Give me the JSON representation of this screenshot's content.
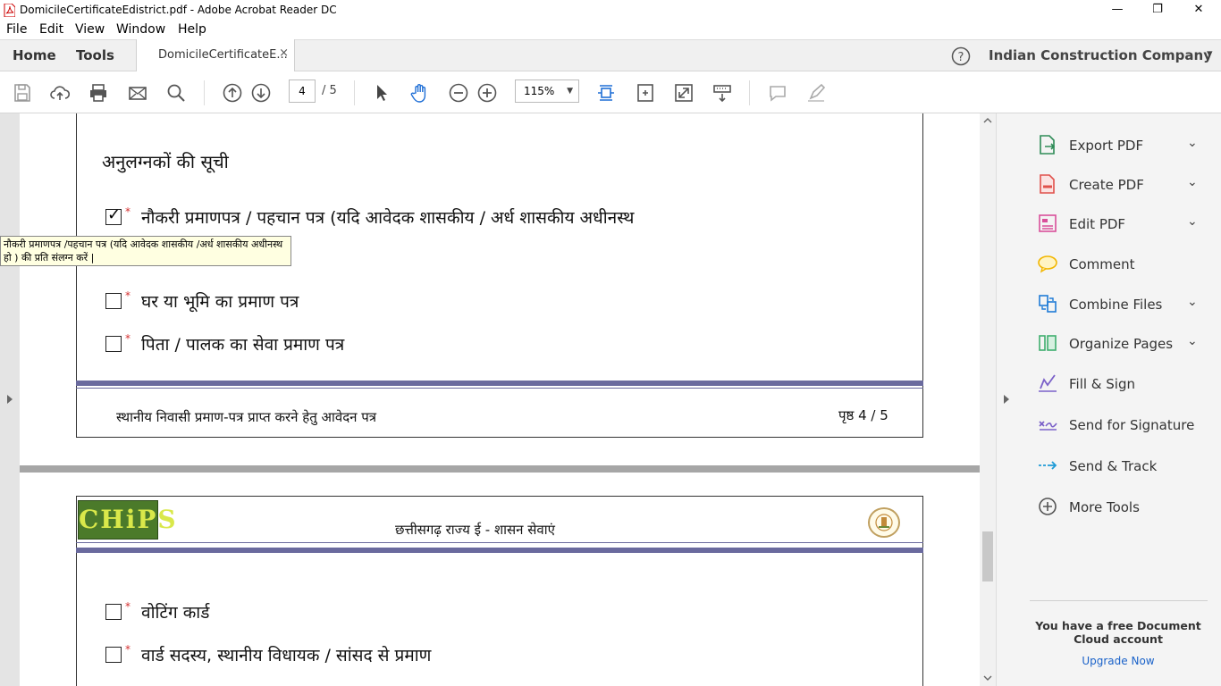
{
  "window": {
    "title": "DomicileCertificateEdistrict.pdf - Adobe Acrobat Reader DC",
    "controls": [
      "—",
      "❐",
      "✕"
    ]
  },
  "menu": [
    "File",
    "Edit",
    "View",
    "Window",
    "Help"
  ],
  "tabs": {
    "home": "Home",
    "tools": "Tools",
    "document": "DomicileCertificateE...",
    "close": "×"
  },
  "account": {
    "help": "?",
    "name": "Indian Construction Company",
    "caret": "▾"
  },
  "toolbar": {
    "page_current": "4",
    "page_total": "/ 5",
    "zoom": "115%",
    "zoom_caret": "▼"
  },
  "document": {
    "page4": {
      "heading": "अनुलग्नकों की सूची",
      "items": [
        {
          "label": "नौकरी प्रमाणपत्र / पहचान पत्र (यदि आवेदक शासकीय / अर्ध शासकीय अधीनस्थ",
          "checked": true
        },
        {
          "label": "घर या भूमि का प्रमाण पत्र",
          "checked": false
        },
        {
          "label": "पिता / पालक का सेवा प्रमाण पत्र",
          "checked": false
        }
      ],
      "required_mark": "*",
      "footer_left": "स्थानीय निवासी प्रमाण-पत्र प्राप्त करने हेतु आवेदन पत्र",
      "footer_right": "पृष्ठ 4 / 5"
    },
    "tooltip": "नौकरी प्रमाणपत्र /पहचान पत्र (यदि आवेदक शासकीय /अर्ध शासकीय अधीनस्थ हो ) की प्रति संलग्न करें |",
    "page5": {
      "logo_text": "CHiPS",
      "header_title": "छत्तीसगढ़ राज्य ई - शासन सेवाएं",
      "items": [
        {
          "label": "वोटिंग कार्ड",
          "checked": false
        },
        {
          "label": "वार्ड सदस्य, स्थानीय विधायक / सांसद से प्रमाण",
          "checked": false
        }
      ]
    }
  },
  "right_panel": {
    "tools": [
      {
        "label": "Export PDF",
        "icon": "export-pdf-icon",
        "color": "#2e8b57",
        "has_chevron": true
      },
      {
        "label": "Create PDF",
        "icon": "create-pdf-icon",
        "color": "#e0524c",
        "has_chevron": true
      },
      {
        "label": "Edit PDF",
        "icon": "edit-pdf-icon",
        "color": "#d94f9a",
        "has_chevron": true
      },
      {
        "label": "Comment",
        "icon": "comment-icon",
        "color": "#f2b600",
        "has_chevron": false
      },
      {
        "label": "Combine Files",
        "icon": "combine-files-icon",
        "color": "#1f7bd6",
        "has_chevron": true
      },
      {
        "label": "Organize Pages",
        "icon": "organize-pages-icon",
        "color": "#3fae6e",
        "has_chevron": true
      },
      {
        "label": "Fill & Sign",
        "icon": "fill-sign-icon",
        "color": "#7b61c9",
        "has_chevron": false
      },
      {
        "label": "Send for Signature",
        "icon": "send-signature-icon",
        "color": "#7b61c9",
        "has_chevron": false
      },
      {
        "label": "Send & Track",
        "icon": "send-track-icon",
        "color": "#1f9bd6",
        "has_chevron": false
      },
      {
        "label": "More Tools",
        "icon": "more-tools-icon",
        "color": "#555555",
        "has_chevron": false
      }
    ],
    "chevron": "⌄",
    "promo": "You have a free Document Cloud account",
    "upgrade": "Upgrade Now"
  }
}
